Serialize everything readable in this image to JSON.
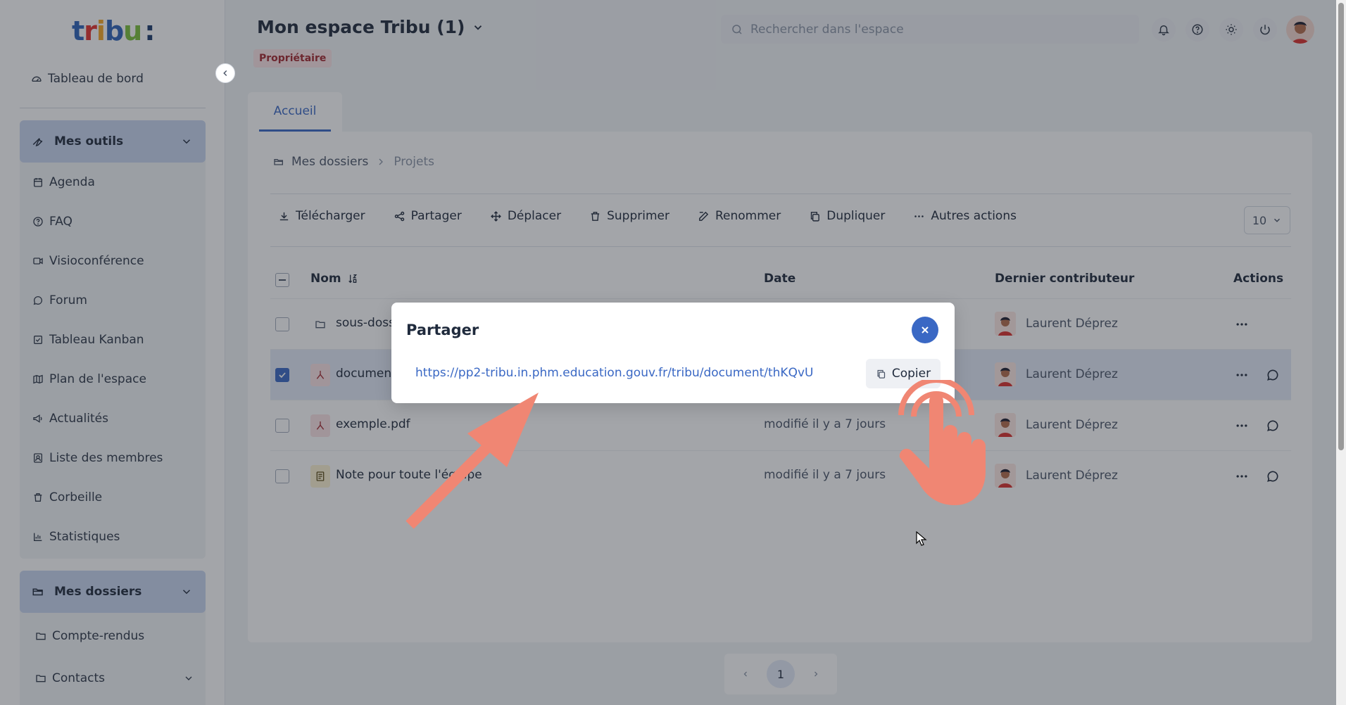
{
  "app": {
    "logo_letters": [
      "t",
      "r",
      "i",
      "b",
      "u",
      ":"
    ],
    "logo_colors": [
      "#2e63b8",
      "#e4312b",
      "#f5a623",
      "#2e63b8",
      "#7bbf3a",
      "#1a3a6b"
    ]
  },
  "sidebar": {
    "dashboard_label": "Tableau de bord",
    "tools_group": {
      "title": "Mes outils",
      "items": [
        {
          "label": "Agenda",
          "icon": "calendar-icon"
        },
        {
          "label": "FAQ",
          "icon": "help-icon"
        },
        {
          "label": "Visioconférence",
          "icon": "video-icon"
        },
        {
          "label": "Forum",
          "icon": "forum-icon"
        },
        {
          "label": "Tableau Kanban",
          "icon": "kanban-icon"
        },
        {
          "label": "Plan de l'espace",
          "icon": "map-icon"
        },
        {
          "label": "Actualités",
          "icon": "megaphone-icon"
        },
        {
          "label": "Liste des membres",
          "icon": "members-icon"
        },
        {
          "label": "Corbeille",
          "icon": "trash-icon"
        },
        {
          "label": "Statistiques",
          "icon": "chart-icon"
        }
      ]
    },
    "folders_group": {
      "title": "Mes dossiers",
      "items": [
        {
          "label": "Compte-rendus",
          "icon": "folder-icon"
        },
        {
          "label": "Contacts",
          "icon": "folder-icon"
        }
      ]
    }
  },
  "header": {
    "space_title": "Mon espace Tribu (1)",
    "role_badge": "Propriétaire",
    "search_placeholder": "Rechercher dans l'espace"
  },
  "tabs": [
    {
      "label": "Accueil",
      "active": true
    }
  ],
  "breadcrumb": {
    "root": "Mes dossiers",
    "current": "Projets"
  },
  "toolbar": {
    "download": "Télécharger",
    "share": "Partager",
    "move": "Déplacer",
    "delete": "Supprimer",
    "rename": "Renommer",
    "duplicate": "Dupliquer",
    "more": "Autres actions",
    "page_size": "10"
  },
  "table": {
    "columns": {
      "name": "Nom",
      "date": "Date",
      "contributor": "Dernier contributeur",
      "actions": "Actions"
    },
    "rows": [
      {
        "name": "sous-dossier",
        "type": "folder",
        "date": "",
        "contributor": "Laurent Déprez",
        "selected": false,
        "has_comment": false
      },
      {
        "name": "document.pdf",
        "type": "pdf",
        "date": "",
        "contributor": "Laurent Déprez",
        "selected": true,
        "has_comment": true
      },
      {
        "name": "exemple.pdf",
        "type": "pdf",
        "date": "modifié il y a 7 jours",
        "contributor": "Laurent Déprez",
        "selected": false,
        "has_comment": true
      },
      {
        "name": "Note pour toute l'équipe",
        "type": "note",
        "date": "modifié il y a 7 jours",
        "contributor": "Laurent Déprez",
        "selected": false,
        "has_comment": true
      }
    ]
  },
  "pagination": {
    "current_page": "1"
  },
  "modal": {
    "title": "Partager",
    "link": "https://pp2-tribu.in.phm.education.gouv.fr/tribu/document/thKQvU",
    "copy_label": "Copier"
  },
  "colors": {
    "accent": "#3a68c4",
    "badge_bg": "#fbe4e6",
    "badge_text": "#a3262e",
    "annotation": "#f08673"
  }
}
